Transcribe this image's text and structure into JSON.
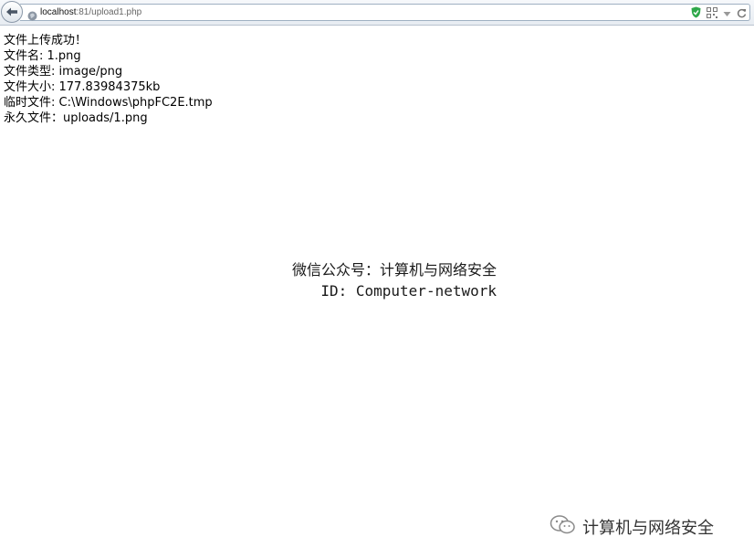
{
  "browser": {
    "url_host": "localhost",
    "url_rest": ":81/upload1.php",
    "icons": [
      "back-arrow-icon",
      "globe-icon",
      "shield-icon",
      "qr-code-icon",
      "dropdown-icon",
      "reload-icon"
    ]
  },
  "page": {
    "lines": [
      "文件上传成功！",
      "文件名: 1.png",
      "文件类型: image/png",
      "文件大小: 177.83984375kb",
      "临时文件: C:\\Windows\\phpFC2E.tmp",
      "永久文件：uploads/1.png"
    ]
  },
  "watermark": {
    "line1": "微信公众号：计算机与网络安全",
    "line2": "ID: Computer-network",
    "corner_text": "计算机与网络安全"
  },
  "colors": {
    "shield": "#2fa84a",
    "toolbar": "#e7ecf2"
  }
}
